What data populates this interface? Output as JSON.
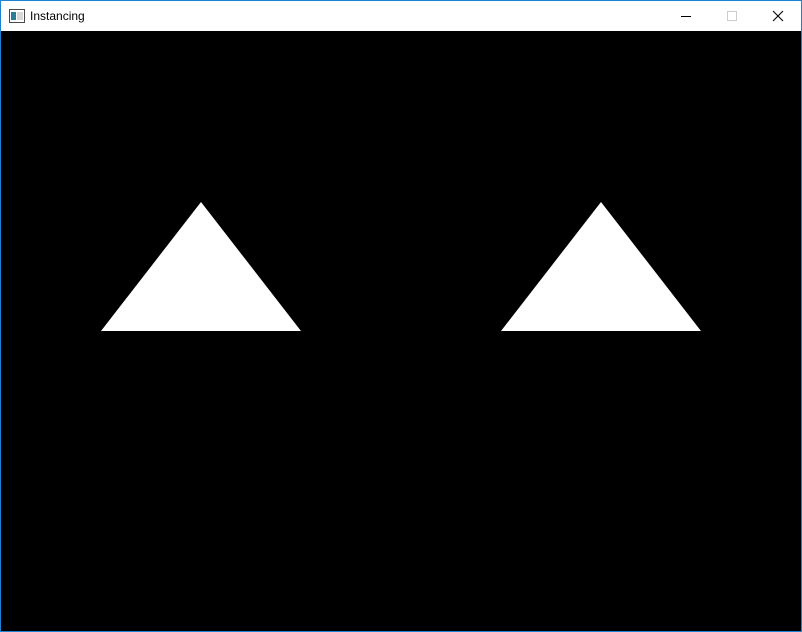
{
  "window": {
    "title": "Instancing",
    "icon": "app-window-icon",
    "controls": {
      "minimize_icon": "minimize-icon",
      "maximize_icon": "maximize-icon",
      "close_icon": "close-icon"
    },
    "border_color": "#1883d7"
  },
  "scene": {
    "background_color": "#000000",
    "shape_color": "#ffffff",
    "instances": [
      {
        "shape": "triangle"
      },
      {
        "shape": "triangle"
      }
    ]
  }
}
